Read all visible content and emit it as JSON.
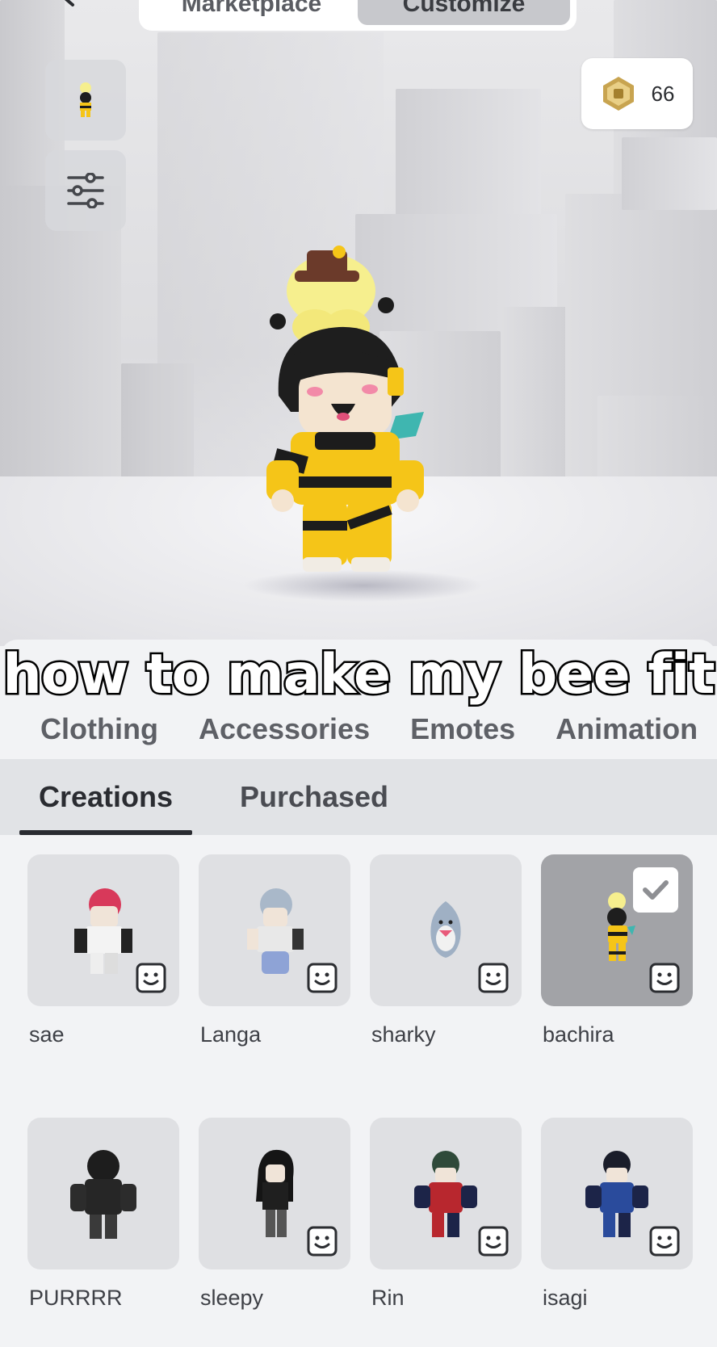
{
  "top_tabs": [
    {
      "label": "Marketplace",
      "active": false
    },
    {
      "label": "Customize",
      "active": true
    }
  ],
  "robux": {
    "amount": "66",
    "icon": "robux-icon"
  },
  "caption": "how to make my bee fit",
  "categories": [
    "Clothing",
    "Accessories",
    "Emotes",
    "Animation"
  ],
  "sub_tabs": [
    {
      "label": "Creations",
      "active": true
    },
    {
      "label": "Purchased",
      "active": false
    }
  ],
  "creations": [
    {
      "name": "sae",
      "selected": false
    },
    {
      "name": "Langa",
      "selected": false
    },
    {
      "name": "sharky",
      "selected": false
    },
    {
      "name": "bachira",
      "selected": true
    },
    {
      "name": "PURRRR",
      "selected": false
    },
    {
      "name": "sleepy",
      "selected": false
    },
    {
      "name": "Rin",
      "selected": false
    },
    {
      "name": "isagi",
      "selected": false
    }
  ],
  "colors": {
    "bee_yellow": "#f5c518",
    "bee_black": "#1c1c1c",
    "selected_card": "#a2a3a7"
  }
}
